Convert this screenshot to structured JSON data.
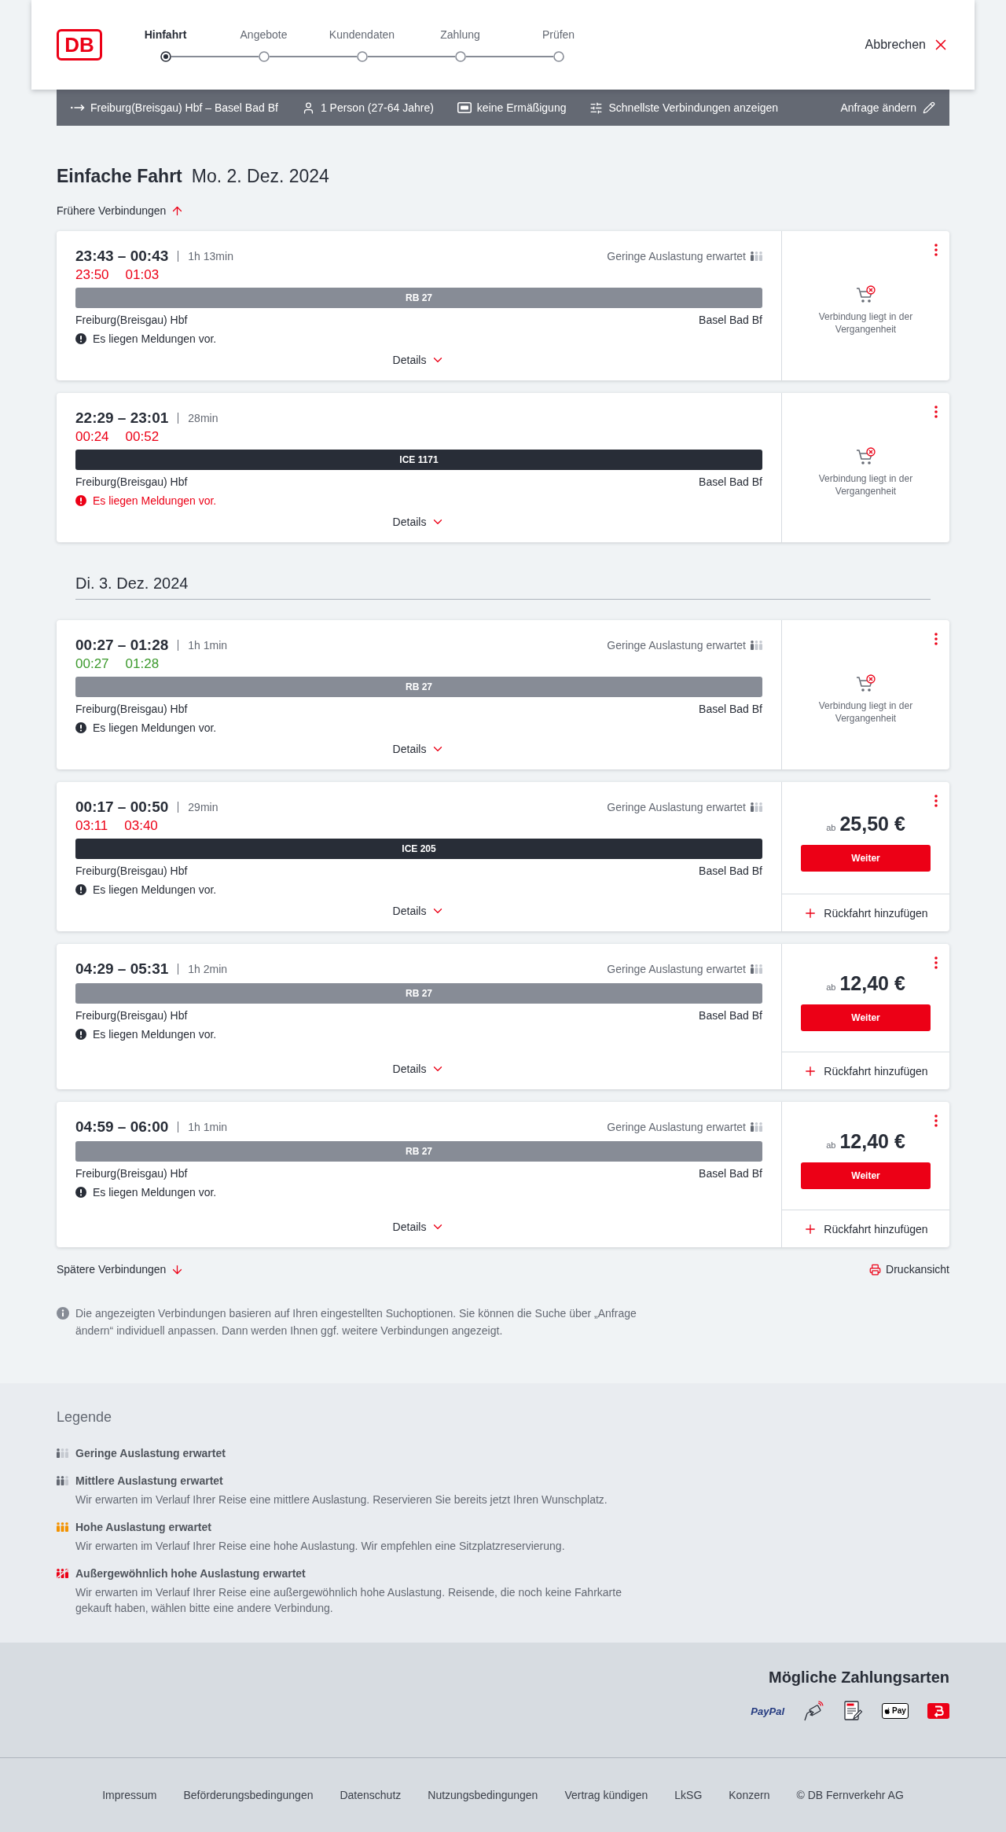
{
  "header": {
    "logo": "DB",
    "steps": [
      {
        "label": "Hinfahrt",
        "selected": true
      },
      {
        "label": "Angebote",
        "selected": false
      },
      {
        "label": "Kundendaten",
        "selected": false
      },
      {
        "label": "Zahlung",
        "selected": false
      },
      {
        "label": "Prüfen",
        "selected": false
      }
    ],
    "cancel": "Abbrechen"
  },
  "search_summary": {
    "route": "Freiburg(Breisgau) Hbf – Basel Bad Bf",
    "passengers": "1 Person (27-64 Jahre)",
    "discount": "keine Ermäßigung",
    "option": "Schnellste Verbindungen anzeigen",
    "edit": "Anfrage ändern"
  },
  "title": {
    "trip_type": "Einfache Fahrt",
    "date": "Mo. 2. Dez. 2024"
  },
  "earlier_link": "Frühere Verbindungen",
  "days": [
    {
      "connections": [
        {
          "times": "23:43 – 00:43",
          "duration": "1h 13min",
          "realtime": {
            "departure": "23:50",
            "arrival": "01:03",
            "on_time": false
          },
          "occupancy": {
            "text": "Geringe Auslastung erwartet",
            "kind": "low"
          },
          "train": {
            "label": "RB 27",
            "kind": "regional"
          },
          "from": "Freiburg(Breisgau) Hbf",
          "to": "Basel Bad Bf",
          "message": {
            "text": "Es liegen Meldungen vor.",
            "critical": false
          },
          "details": "Details",
          "offer": {
            "kind": "past",
            "text": "Verbindung liegt in der Vergangenheit"
          }
        },
        {
          "times": "22:29 – 23:01",
          "duration": "28min",
          "realtime": {
            "departure": "00:24",
            "arrival": "00:52",
            "on_time": false
          },
          "train": {
            "label": "ICE 1171",
            "kind": "long_distance"
          },
          "from": "Freiburg(Breisgau) Hbf",
          "to": "Basel Bad Bf",
          "message": {
            "text": "Es liegen Meldungen vor.",
            "critical": true
          },
          "details": "Details",
          "offer": {
            "kind": "past",
            "text": "Verbindung liegt in der Vergangenheit"
          }
        }
      ]
    },
    {
      "date": "Di. 3. Dez. 2024",
      "connections": [
        {
          "times": "00:27 – 01:28",
          "duration": "1h 1min",
          "realtime": {
            "departure": "00:27",
            "arrival": "01:28",
            "on_time": true
          },
          "occupancy": {
            "text": "Geringe Auslastung erwartet",
            "kind": "low"
          },
          "train": {
            "label": "RB 27",
            "kind": "regional"
          },
          "from": "Freiburg(Breisgau) Hbf",
          "to": "Basel Bad Bf",
          "message": {
            "text": "Es liegen Meldungen vor.",
            "critical": false
          },
          "details": "Details",
          "offer": {
            "kind": "past",
            "text": "Verbindung liegt in der Vergangenheit"
          }
        },
        {
          "times": "00:17 – 00:50",
          "duration": "29min",
          "realtime": {
            "departure": "03:11",
            "arrival": "03:40",
            "on_time": false
          },
          "occupancy": {
            "text": "Geringe Auslastung erwartet",
            "kind": "low"
          },
          "train": {
            "label": "ICE 205",
            "kind": "long_distance"
          },
          "from": "Freiburg(Breisgau) Hbf",
          "to": "Basel Bad Bf",
          "message": {
            "text": "Es liegen Meldungen vor.",
            "critical": false
          },
          "details": "Details",
          "offer": {
            "kind": "price",
            "prefix": "ab",
            "price": "25,50 €",
            "button": "Weiter",
            "return_trip": "Rückfahrt hinzufügen"
          }
        },
        {
          "times": "04:29 – 05:31",
          "duration": "1h 2min",
          "occupancy": {
            "text": "Geringe Auslastung erwartet",
            "kind": "low"
          },
          "train": {
            "label": "RB 27",
            "kind": "regional"
          },
          "from": "Freiburg(Breisgau) Hbf",
          "to": "Basel Bad Bf",
          "message": {
            "text": "Es liegen Meldungen vor.",
            "critical": false
          },
          "details": "Details",
          "offer": {
            "kind": "price",
            "prefix": "ab",
            "price": "12,40 €",
            "button": "Weiter",
            "return_trip": "Rückfahrt hinzufügen"
          }
        },
        {
          "times": "04:59 – 06:00",
          "duration": "1h 1min",
          "occupancy": {
            "text": "Geringe Auslastung erwartet",
            "kind": "low"
          },
          "train": {
            "label": "RB 27",
            "kind": "regional"
          },
          "from": "Freiburg(Breisgau) Hbf",
          "to": "Basel Bad Bf",
          "message": {
            "text": "Es liegen Meldungen vor.",
            "critical": false
          },
          "details": "Details",
          "offer": {
            "kind": "price",
            "prefix": "ab",
            "price": "12,40 €",
            "button": "Weiter",
            "return_trip": "Rückfahrt hinzufügen"
          }
        }
      ]
    }
  ],
  "later_link": "Spätere Verbindungen",
  "print_link": "Druckansicht",
  "info_note": "Die angezeigten Verbindungen basieren auf Ihren eingestellten Suchoptionen. Sie können die Suche über „Anfrage ändern“ individuell anpassen. Dann werden Ihnen ggf. weitere Verbindungen angezeigt.",
  "legend": {
    "title": "Legende",
    "items": [
      {
        "kind": "low",
        "title": "Geringe Auslastung erwartet"
      },
      {
        "kind": "medium",
        "title": "Mittlere Auslastung erwartet",
        "description": "Wir erwarten im Verlauf Ihrer Reise eine mittlere Auslastung. Reservieren Sie bereits jetzt Ihren Wunschplatz."
      },
      {
        "kind": "high",
        "title": "Hohe Auslastung erwartet",
        "description": "Wir erwarten im Verlauf Ihrer Reise eine hohe Auslastung. Wir empfehlen eine Sitzplatzreservierung."
      },
      {
        "kind": "exceptional",
        "title": "Außergewöhnlich hohe Auslastung erwartet",
        "description": "Wir erwarten im Verlauf Ihrer Reise eine außergewöhnlich hohe Auslastung. Reisende, die noch keine Fahrkarte gekauft haben, wählen bitte eine andere Verbindung."
      }
    ]
  },
  "payment": {
    "title": "Mögliche Zahlungsarten",
    "methods": [
      {
        "kind": "paypal",
        "label": "PayPal"
      },
      {
        "kind": "card"
      },
      {
        "kind": "sepa"
      },
      {
        "kind": "applepay",
        "label": "Pay"
      },
      {
        "kind": "app"
      }
    ]
  },
  "footer": {
    "links": [
      "Impressum",
      "Beförderungsbedingungen",
      "Datenschutz",
      "Nutzungsbedingungen",
      "Vertrag kündigen",
      "LkSG",
      "Konzern"
    ],
    "copyright": "© DB Fernverkehr AG"
  }
}
